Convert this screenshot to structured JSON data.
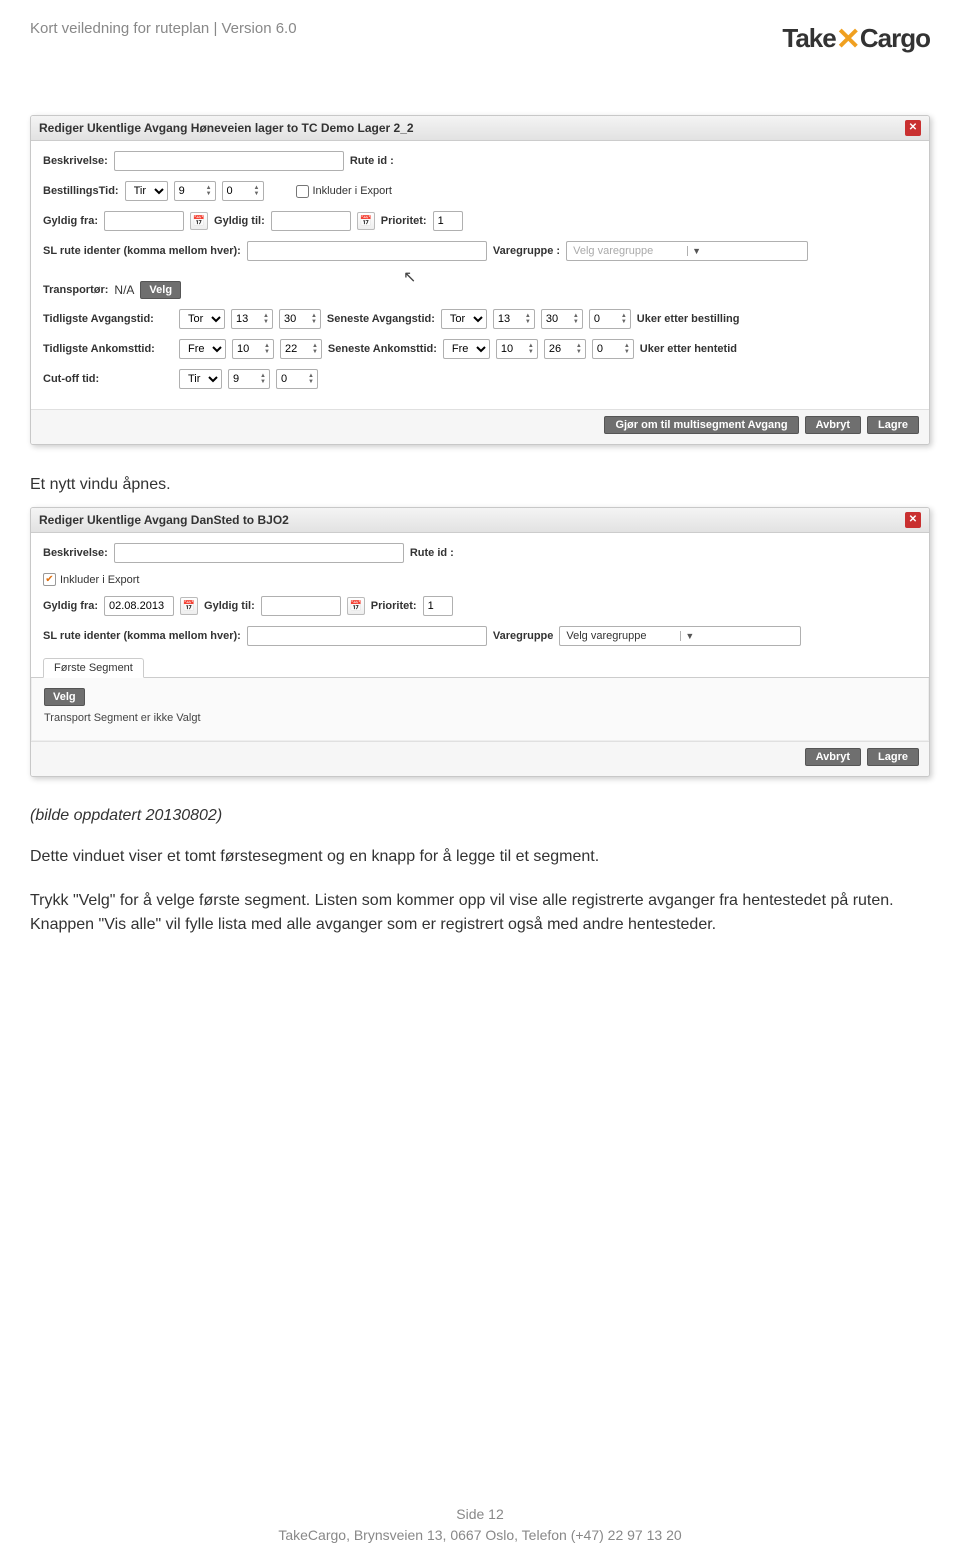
{
  "header": {
    "doc_title": "Kort veiledning for ruteplan | Version 6.0",
    "logo_take": "Take",
    "logo_cargo": "Cargo"
  },
  "dialog1": {
    "title": "Rediger Ukentlige Avgang Høneveien lager to  TC Demo Lager 2_2",
    "labels": {
      "beskrivelse": "Beskrivelse:",
      "rute_id": "Rute id :",
      "bestillingstid": "BestillingsTid:",
      "inkluder_export": "Inkluder i Export",
      "gyldig_fra": "Gyldig fra:",
      "gyldig_til": "Gyldig til:",
      "prioritet": "Prioritet:",
      "sl_rute": "SL rute identer (komma mellom hver):",
      "varegruppe": "Varegruppe :",
      "varegruppe_ph": "Velg varegruppe",
      "transportor": "Transportør:",
      "transportor_val": "N/A",
      "velg": "Velg",
      "tidligste_avg": "Tidligste Avgangstid:",
      "seneste_avg": "Seneste Avgangstid:",
      "uker_bestilling": "Uker etter bestilling",
      "tidligste_ank": "Tidligste Ankomsttid:",
      "seneste_ank": "Seneste Ankomsttid:",
      "uker_hentetid": "Uker etter hentetid",
      "cutoff": "Cut-off tid:"
    },
    "values": {
      "best_dag": "Tir",
      "best_t": "9",
      "best_m": "0",
      "prioritet": "1",
      "tavg_dag": "Tor",
      "tavg_t": "13",
      "tavg_m": "30",
      "savg_dag": "Tor",
      "savg_t": "13",
      "savg_m": "30",
      "savg_uker": "0",
      "tank_dag": "Fre",
      "tank_t": "10",
      "tank_m": "22",
      "sank_dag": "Fre",
      "sank_t": "10",
      "sank_m": "26",
      "sank_uker": "0",
      "cut_dag": "Tir",
      "cut_t": "9",
      "cut_m": "0"
    },
    "buttons": {
      "multi": "Gjør om til multisegment Avgang",
      "avbryt": "Avbryt",
      "lagre": "Lagre"
    }
  },
  "caption1": "Et nytt vindu åpnes.",
  "dialog2": {
    "title": "Rediger Ukentlige Avgang DanSted to BJO2",
    "labels": {
      "beskrivelse": "Beskrivelse:",
      "rute_id": "Rute id :",
      "inkluder_export": "Inkluder i Export",
      "gyldig_fra": "Gyldig fra:",
      "gyldig_til": "Gyldig til:",
      "prioritet": "Prioritet:",
      "sl_rute": "SL rute identer (komma mellom hver):",
      "varegruppe": "Varegruppe",
      "varegruppe_val": "Velg varegruppe",
      "tab": "Første Segment",
      "velg": "Velg",
      "segment_msg": "Transport Segment er ikke Valgt"
    },
    "values": {
      "gyldig_fra": "02.08.2013",
      "prioritet": "1"
    },
    "buttons": {
      "avbryt": "Avbryt",
      "lagre": "Lagre"
    }
  },
  "caption2": "(bilde oppdatert 20130802)",
  "para1": "Dette vinduet viser et tomt førstesegment og en knapp for å legge til et segment.",
  "para2": "Trykk \"Velg\" for å velge første segment. Listen som kommer opp vil vise alle registrerte avganger fra hentestedet på ruten. Knappen \"Vis alle\" vil fylle lista med alle avganger som er registrert også med andre hentesteder.",
  "footer": {
    "line1": "Side 12",
    "line2": "TakeCargo, Brynsveien 13, 0667 Oslo, Telefon (+47)  22 97 13 20"
  }
}
